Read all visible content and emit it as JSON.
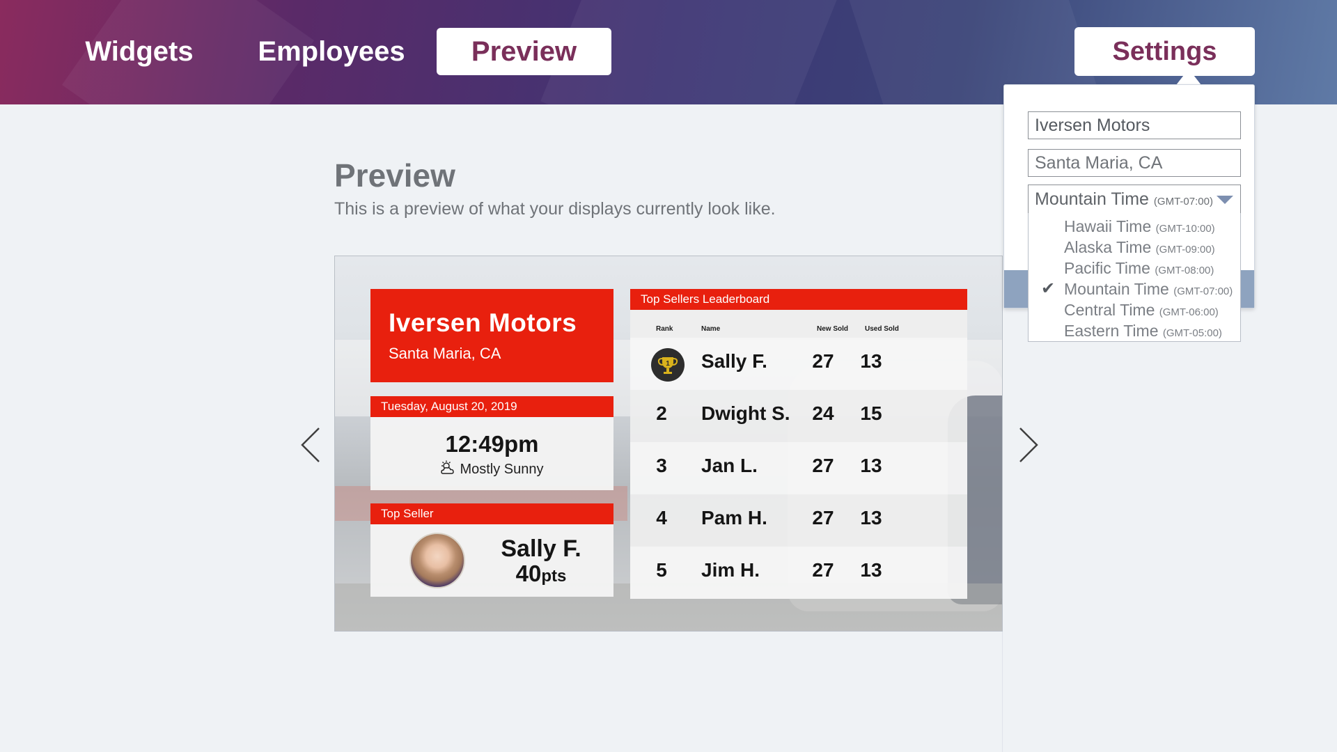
{
  "nav": {
    "tabs": [
      {
        "label": "Widgets"
      },
      {
        "label": "Employees"
      },
      {
        "label": "Preview",
        "active": true
      }
    ],
    "settings_label": "Settings"
  },
  "settings": {
    "dealer_name": "Iversen Motors",
    "location": "Santa Maria, CA",
    "timezone": {
      "selected_name": "Mountain Time",
      "selected_offset": "(GMT-07:00)",
      "options": [
        {
          "name": "Hawaii Time",
          "offset": "(GMT-10:00)",
          "checked": false
        },
        {
          "name": "Alaska Time",
          "offset": "(GMT-09:00)",
          "checked": false
        },
        {
          "name": "Pacific Time",
          "offset": "(GMT-08:00)",
          "checked": false
        },
        {
          "name": "Mountain Time",
          "offset": "(GMT-07:00)",
          "checked": true
        },
        {
          "name": "Central Time",
          "offset": "(GMT-06:00)",
          "checked": false
        },
        {
          "name": "Eastern Time",
          "offset": "(GMT-05:00)",
          "checked": false
        }
      ]
    }
  },
  "main": {
    "title": "Preview",
    "subtitle": "This is a preview of what your displays currently look like."
  },
  "display": {
    "dealer_name": "Iversen Motors",
    "dealer_location": "Santa Maria, CA",
    "date": "Tuesday, August 20, 2019",
    "time": "12:49pm",
    "weather": "Mostly Sunny",
    "weather_icon": "partly-sunny-icon",
    "top_seller": {
      "header": "Top Seller",
      "name": "Sally F.",
      "points": "40",
      "points_unit": "pts"
    },
    "leaderboard": {
      "title": "Top Sellers Leaderboard",
      "columns": [
        "Rank",
        "Name",
        "New Sold",
        "Used Sold"
      ],
      "rows": [
        {
          "rank": "",
          "rank_icon": "trophy-icon",
          "name": "Sally F.",
          "new": "27",
          "used": "13"
        },
        {
          "rank": "2",
          "name": "Dwight S.",
          "new": "24",
          "used": "15"
        },
        {
          "rank": "3",
          "name": "Jan L.",
          "new": "27",
          "used": "13"
        },
        {
          "rank": "4",
          "name": "Pam H.",
          "new": "27",
          "used": "13"
        },
        {
          "rank": "5",
          "name": "Jim H.",
          "new": "27",
          "used": "13"
        }
      ]
    }
  },
  "colors": {
    "brand_red": "#e8200e",
    "accent_purple": "#7a2f5a",
    "header_gradient_start": "#8a2b5e",
    "header_gradient_end": "#5f7aa6"
  }
}
